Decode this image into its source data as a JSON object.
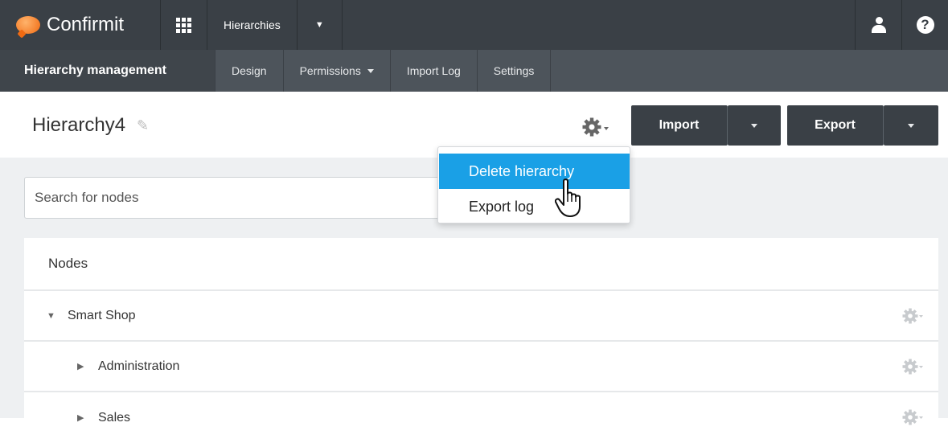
{
  "topnav": {
    "brand": "Confirmit",
    "section": "Hierarchies",
    "colors": {
      "bar": "#3a4046",
      "accent": "#f06a12"
    }
  },
  "subnav": {
    "title": "Hierarchy management",
    "tabs": [
      {
        "label": "Design"
      },
      {
        "label": "Permissions"
      },
      {
        "label": "Import Log"
      },
      {
        "label": "Settings"
      }
    ]
  },
  "header": {
    "title": "Hierarchy4",
    "import_label": "Import",
    "export_label": "Export"
  },
  "menu": {
    "items": [
      {
        "label": "Delete hierarchy",
        "active": true
      },
      {
        "label": "Export log",
        "active": false
      }
    ],
    "highlight_color": "#1aa0e6"
  },
  "search": {
    "placeholder": "Search for nodes"
  },
  "nodes": {
    "header": "Nodes",
    "rows": [
      {
        "label": "Smart Shop",
        "expanded": true
      },
      {
        "label": "Administration",
        "expanded": false
      },
      {
        "label": "Sales",
        "expanded": false
      }
    ]
  }
}
